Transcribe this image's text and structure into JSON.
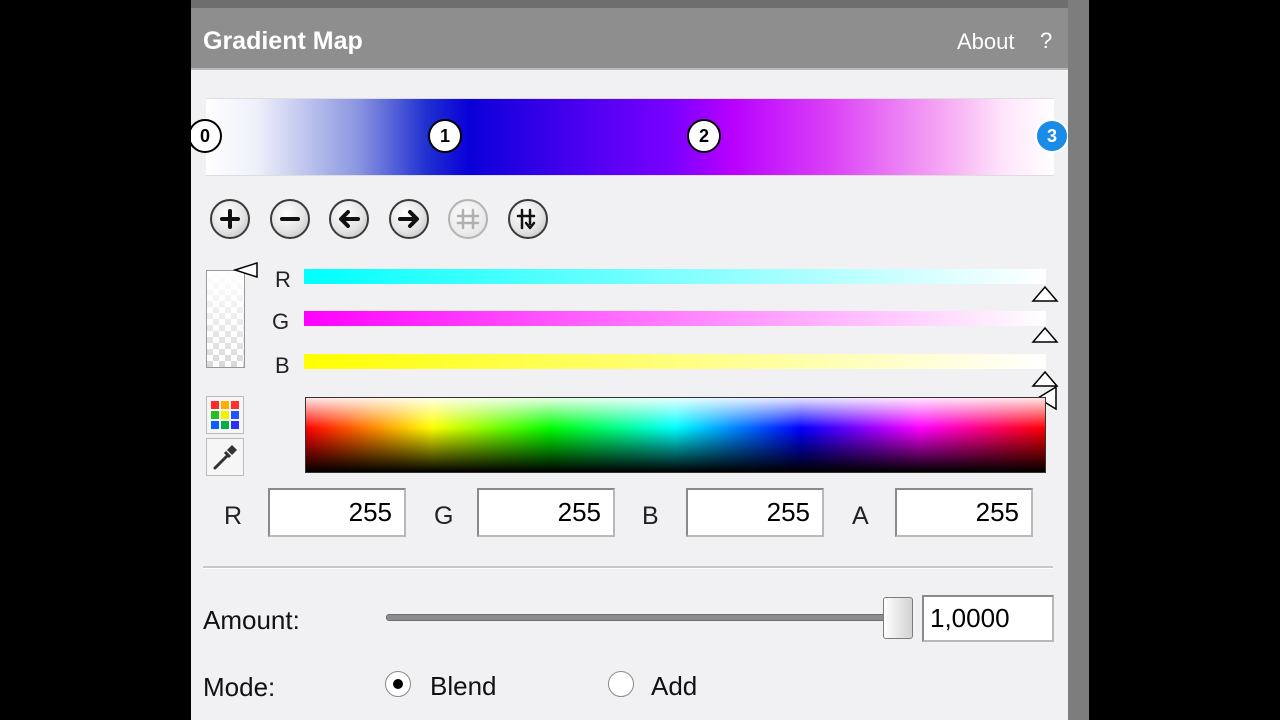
{
  "panel": {
    "title": "Gradient Map",
    "about_label": "About",
    "help_label": "?"
  },
  "gradient": {
    "stops": [
      {
        "label": "0"
      },
      {
        "label": "1"
      },
      {
        "label": "2"
      },
      {
        "label": "3"
      }
    ],
    "toolbar": [
      {
        "name": "add-stop",
        "icon": "plus-icon"
      },
      {
        "name": "remove-stop",
        "icon": "minus-icon"
      },
      {
        "name": "move-left",
        "icon": "arrow-left-icon"
      },
      {
        "name": "move-right",
        "icon": "arrow-right-icon"
      },
      {
        "name": "distribute",
        "icon": "distribute-icon",
        "disabled": true
      },
      {
        "name": "reverse",
        "icon": "reverse-icon"
      }
    ]
  },
  "channels": {
    "r_label": "R",
    "g_label": "G",
    "b_label": "B",
    "r_color": "#00ffff",
    "g_color": "#ff00ff",
    "b_color": "#ffff00"
  },
  "color_values": {
    "r_label": "R",
    "r": "255",
    "g_label": "G",
    "g": "255",
    "b_label": "B",
    "b": "255",
    "a_label": "A",
    "a": "255"
  },
  "amount": {
    "label": "Amount:",
    "value": "1,0000",
    "slider_fraction": 1.0
  },
  "mode": {
    "label": "Mode:",
    "options": [
      {
        "label": "Blend",
        "selected": true
      },
      {
        "label": "Add",
        "selected": false
      }
    ]
  }
}
